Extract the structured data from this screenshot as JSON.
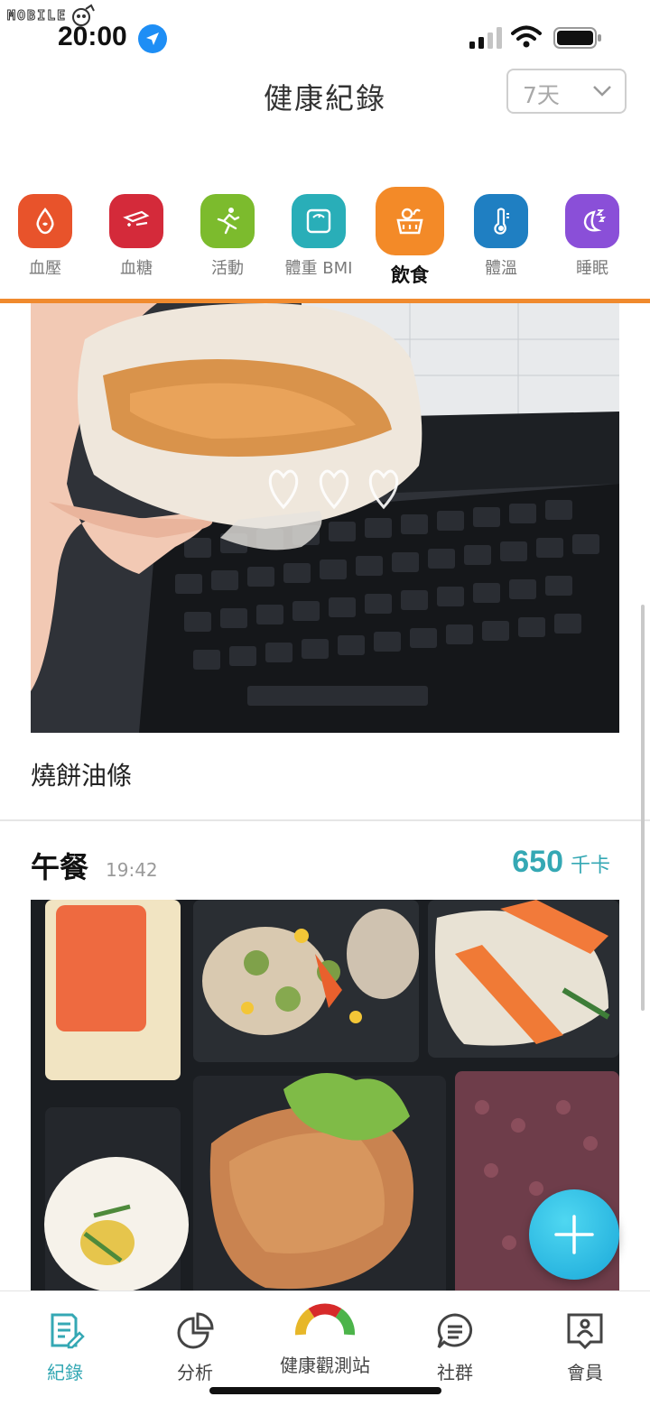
{
  "status_bar": {
    "watermark": "MOBILE",
    "time": "20:00",
    "icons": [
      "location-arrow-icon",
      "cellular-signal-icon",
      "wifi-icon",
      "battery-icon"
    ]
  },
  "header": {
    "title": "健康紀錄",
    "range_select": {
      "value": "7天",
      "icon": "chevron-down-icon"
    }
  },
  "categories": [
    {
      "label": "血壓",
      "icon": "blood-drop-icon",
      "color": "#e8532b",
      "active": false
    },
    {
      "label": "血糖",
      "icon": "glucose-meter-icon",
      "color": "#d42a3a",
      "active": false
    },
    {
      "label": "活動",
      "icon": "running-person-icon",
      "color": "#7cbb2d",
      "active": false
    },
    {
      "label": "體重 BMI",
      "icon": "scale-icon",
      "color": "#29aeb8",
      "active": false
    },
    {
      "label": "飲食",
      "icon": "food-basket-icon",
      "color": "#f38a28",
      "active": true
    },
    {
      "label": "體溫",
      "icon": "thermometer-icon",
      "color": "#1f7fc2",
      "active": false
    },
    {
      "label": "睡眠",
      "icon": "moon-sleep-icon",
      "color": "#8a4fd8",
      "active": false
    }
  ],
  "accent_color": "#f08a2e",
  "feed": {
    "entry1": {
      "caption": "燒餅油條",
      "photo": "hand-holding-flatbread-over-laptop-keyboard"
    },
    "entry2": {
      "meal": "午餐",
      "time": "19:42",
      "kcal_value": "650",
      "kcal_unit": "千卡",
      "photo": "bento-box-with-chicken-rice-vegetables"
    }
  },
  "fab": {
    "icon": "plus-icon"
  },
  "tabbar": {
    "active_color": "#35a8b4",
    "tabs": [
      {
        "label": "紀錄",
        "icon": "records-edit-icon",
        "active": true
      },
      {
        "label": "分析",
        "icon": "pie-chart-icon",
        "active": false
      },
      {
        "label": "健康觀測站",
        "icon": "health-gauge-icon",
        "active": false
      },
      {
        "label": "社群",
        "icon": "chat-bubble-icon",
        "active": false
      },
      {
        "label": "會員",
        "icon": "member-profile-icon",
        "active": false
      }
    ]
  }
}
